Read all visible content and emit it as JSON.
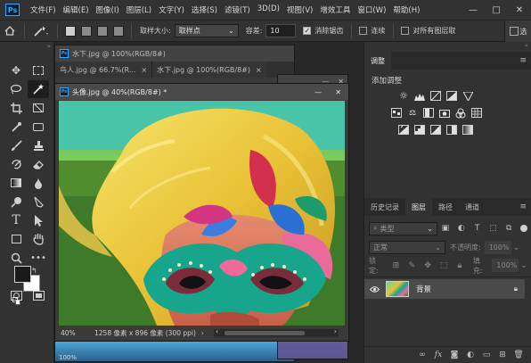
{
  "app": {
    "logo": "Ps"
  },
  "menu": [
    "文件(F)",
    "编辑(E)",
    "图像(I)",
    "图层(L)",
    "文字(Y)",
    "选择(S)",
    "滤镜(T)",
    "3D(D)",
    "视图(V)",
    "增效工具",
    "窗口(W)",
    "帮助(H)"
  ],
  "window_controls": [
    "—",
    "□",
    "✕"
  ],
  "options": {
    "sample_size_label": "取样大小:",
    "sample_size_value": "取样点",
    "tolerance_label": "容差:",
    "tolerance_value": "10",
    "antialias_label": "消除锯齿",
    "contiguous_label": "连续",
    "all_layers_label": "对所有图层取",
    "select_label": "选"
  },
  "documents": {
    "bg_tab_title": "水下.jpg @ 100%(RGB/8#)",
    "tab_bird": "鸟人.jpg @ 66.7%(R...",
    "tab_water": "水下.jpg @ 100%(RGB/8#)",
    "active_title": "头像.jpg @ 40%(RGB/8#) *",
    "status_zoom": "40%",
    "status_info": "1258 像素 x 896 像素 (300 ppi)",
    "back_zoom": "100%"
  },
  "adjustments": {
    "panel_title": "调整",
    "add_label": "添加调整"
  },
  "layers": {
    "tabs": [
      "历史记录",
      "图层",
      "路径",
      "通道"
    ],
    "active_tab": "图层",
    "filter_placeholder": "类型",
    "blend_mode": "正常",
    "opacity_label": "不透明度:",
    "opacity_value": "100%",
    "lock_label": "锁定:",
    "fill_label": "填充:",
    "fill_value": "100%",
    "layer_name": "背景"
  },
  "colors": {
    "accent": "#31a8ff",
    "foreground": "#1a1a1a",
    "background": "#ffffff"
  }
}
